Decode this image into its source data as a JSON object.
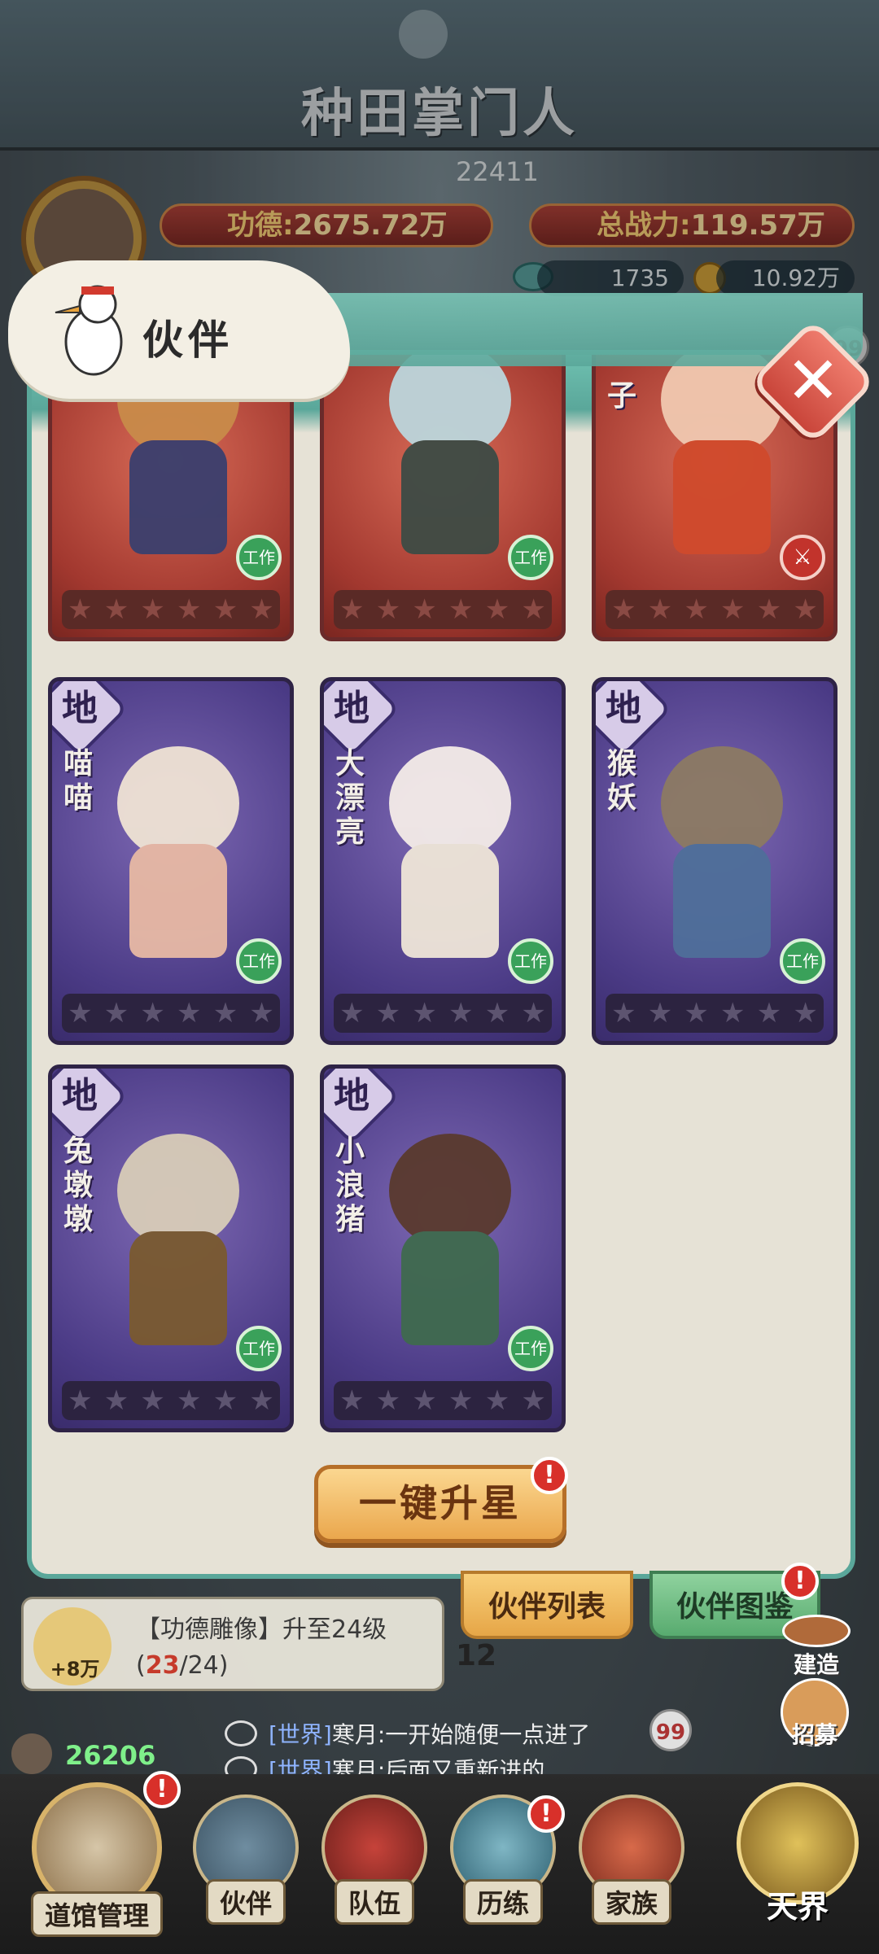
{
  "game": {
    "title": "种田掌门人"
  },
  "header": {
    "merit_label": "功德:",
    "merit_value": "2675.72万",
    "power_label": "总战力:",
    "power_value": "119.57万",
    "top_score": "22411",
    "fish_count": "1735",
    "coin_count": "10.92万",
    "badge_count": "99"
  },
  "modal": {
    "title": "伙伴",
    "close_glyph": "✕",
    "cards": [
      {
        "grade": "",
        "name": "",
        "theme": "red",
        "tag": "工作",
        "stars": [
          "★",
          "★",
          "★",
          "★",
          "★",
          "★"
        ]
      },
      {
        "grade": "",
        "name": "",
        "theme": "red",
        "tag": "工作",
        "stars": [
          "★",
          "★",
          "★",
          "★",
          "★",
          "★"
        ]
      },
      {
        "grade": "",
        "name": "子",
        "theme": "red",
        "tag": "⚔",
        "stars": [
          "★",
          "★",
          "★",
          "★",
          "★",
          "★"
        ]
      },
      {
        "grade": "地",
        "name": "喵喵",
        "theme": "purple",
        "tag": "工作",
        "stars": [
          "★",
          "★",
          "★",
          "★",
          "★",
          "★"
        ]
      },
      {
        "grade": "地",
        "name": "大漂亮",
        "theme": "purple",
        "tag": "工作",
        "stars": [
          "★",
          "★",
          "★",
          "★",
          "★",
          "★"
        ]
      },
      {
        "grade": "地",
        "name": "猴妖",
        "theme": "purple",
        "tag": "工作",
        "stars": [
          "★",
          "★",
          "★",
          "★",
          "★",
          "★"
        ]
      },
      {
        "grade": "地",
        "name": "兔墩墩",
        "theme": "purple",
        "tag": "工作",
        "stars": [
          "★",
          "★",
          "★",
          "★",
          "★",
          "★"
        ]
      },
      {
        "grade": "地",
        "name": "小浪猪",
        "theme": "purple",
        "tag": "工作",
        "stars": [
          "★",
          "★",
          "★",
          "★",
          "★",
          "★"
        ]
      }
    ],
    "upgrade_button": "一键升星",
    "alert_glyph": "!",
    "tab_list": "伙伴列表",
    "tab_codex": "伙伴图鉴"
  },
  "quest": {
    "reward": "+8万",
    "text_prefix": "【功德雕像】升至24级(",
    "progress_current": "23",
    "progress_rest": "/24)",
    "day": "12"
  },
  "chat": {
    "player_score": "26206",
    "lines": [
      {
        "channel": "[世界]",
        "text": "寒月:一开始随便一点进了"
      },
      {
        "channel": "[世界]",
        "text": "寒月:后面又重新进的"
      }
    ],
    "badge_count": "99"
  },
  "side": {
    "build": "建造",
    "recruit": "招募"
  },
  "nav": {
    "dojo": "道馆管理",
    "partner": "伙伴",
    "team": "队伍",
    "trial": "历练",
    "family": "家族",
    "heaven": "天界"
  },
  "colors": {
    "modal_border": "#5aa79a",
    "card_purple": "#4b3b86",
    "card_red": "#a2382f",
    "button_gold": "#eaa74d",
    "alert_red": "#d8302a"
  }
}
